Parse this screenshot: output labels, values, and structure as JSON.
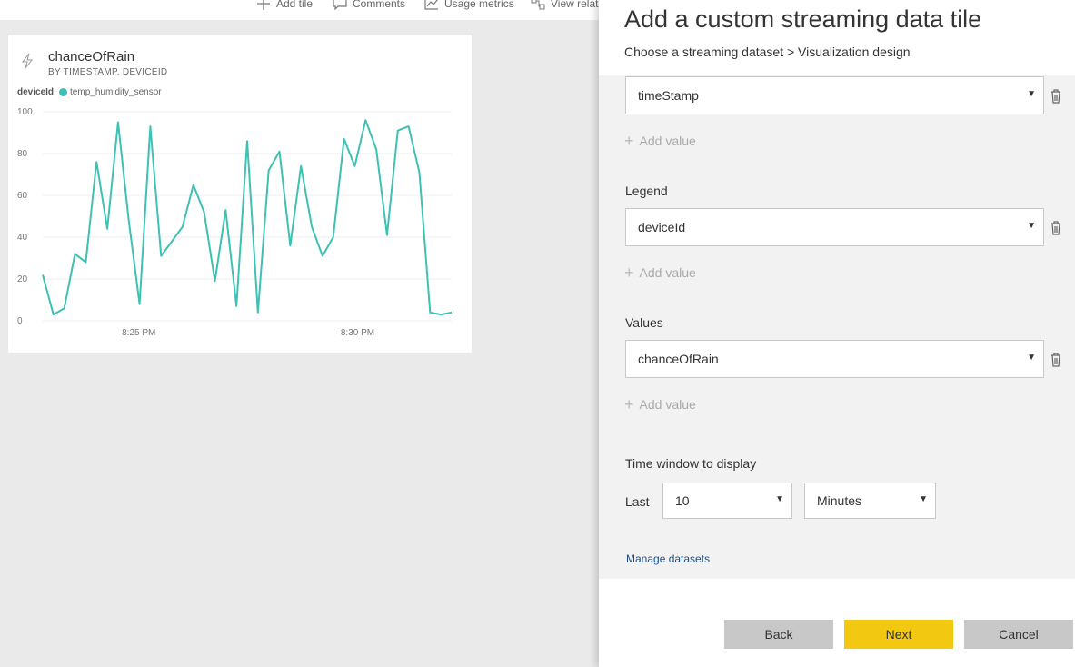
{
  "toolbar": {
    "items": [
      {
        "label": "Add tile",
        "icon": "plus-icon"
      },
      {
        "label": "Comments",
        "icon": "comment-icon"
      },
      {
        "label": "Usage metrics",
        "icon": "chart-icon"
      },
      {
        "label": "View relat",
        "icon": "related-icon"
      }
    ]
  },
  "tile": {
    "title": "chanceOfRain",
    "subtitle": "BY TIMESTAMP, DEVICEID",
    "icon": "lightning-icon",
    "legend_key": "deviceId",
    "legend_item": "temp_humidity_sensor",
    "series_color": "#3dc1b3"
  },
  "chart_data": {
    "type": "line",
    "title": "chanceOfRain",
    "xlabel": "",
    "ylabel": "",
    "ylim": [
      0,
      100
    ],
    "yticks": [
      0,
      20,
      40,
      60,
      80,
      100
    ],
    "xticks": [
      "8:25 PM",
      "8:30 PM"
    ],
    "series": [
      {
        "name": "temp_humidity_sensor",
        "values": [
          22,
          3,
          6,
          32,
          28,
          76,
          44,
          95,
          48,
          8,
          93,
          31,
          38,
          45,
          65,
          52,
          19,
          53,
          7,
          86,
          4,
          72,
          81,
          36,
          74,
          45,
          31,
          40,
          87,
          74,
          96,
          82,
          41,
          91,
          93,
          71,
          4,
          3,
          4
        ]
      }
    ],
    "grid": true
  },
  "panel": {
    "title": "Add a custom streaming data tile",
    "breadcrumb": "Choose a streaming dataset > Visualization design",
    "axis_value": "timeStamp",
    "add_value_1": "Add value",
    "legend_label": "Legend",
    "legend_value": "deviceId",
    "add_value_2": "Add value",
    "values_label": "Values",
    "values_value": "chanceOfRain",
    "add_value_3": "Add value",
    "time_window_label": "Time window to display",
    "last_label": "Last",
    "last_value": "10",
    "unit_value": "Minutes",
    "manage_link": "Manage datasets",
    "back_label": "Back",
    "next_label": "Next",
    "cancel_label": "Cancel",
    "accent_color": "#f2c811"
  }
}
